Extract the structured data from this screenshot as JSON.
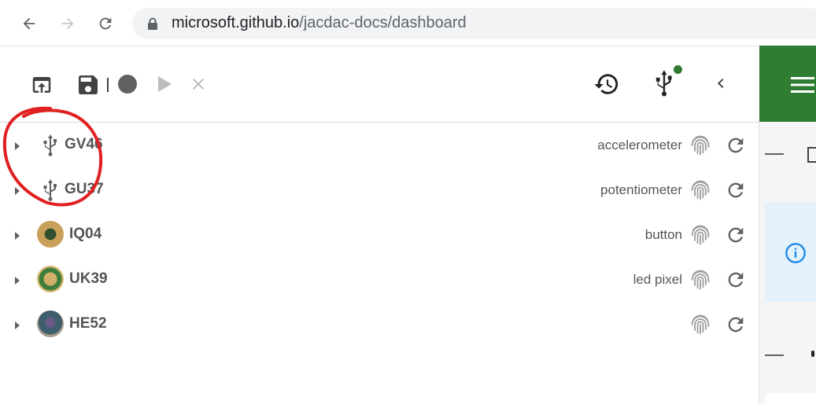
{
  "browser": {
    "url_host": "microsoft.github.io",
    "url_path": "/jacdac-docs/dashboard"
  },
  "devices": [
    {
      "name": "GV46",
      "service": "accelerometer",
      "icon": "usb-icon"
    },
    {
      "name": "GU37",
      "service": "potentiometer",
      "icon": "usb-icon"
    },
    {
      "name": "IQ04",
      "service": "button",
      "icon": "device-avatar"
    },
    {
      "name": "UK39",
      "service": "led pixel",
      "icon": "device-avatar"
    },
    {
      "name": "HE52",
      "service": "",
      "icon": "device-avatar"
    }
  ],
  "colors": {
    "header_green": "#2e7d32",
    "status_dot": "#2e7d32",
    "annotation_red": "#e02020",
    "info_blue": "#1e88e5"
  }
}
